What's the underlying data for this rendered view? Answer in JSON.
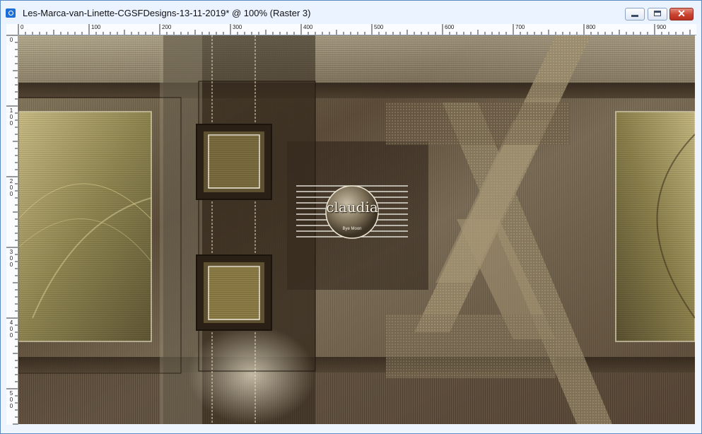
{
  "window": {
    "title": "Les-Marca-van-Linette-CGSFDesigns-13-11-2019* @ 100% (Raster 3)",
    "controls": {
      "minimize": "minimize",
      "maximize": "maximize",
      "close": "✕"
    }
  },
  "ruler_horizontal": {
    "labels": [
      "0",
      "100",
      "200",
      "300",
      "400",
      "500",
      "600",
      "700",
      "800",
      "900"
    ]
  },
  "ruler_vertical": {
    "labels": [
      [
        "0"
      ],
      [
        "1",
        "0",
        "0"
      ],
      [
        "2",
        "0",
        "0"
      ],
      [
        "3",
        "0",
        "0"
      ],
      [
        "4",
        "0",
        "0"
      ],
      [
        "5",
        "0",
        "0"
      ]
    ]
  },
  "watermark": {
    "text": "claudia",
    "subtext": "Bye Moon"
  },
  "colors": {
    "frame": "#5c8ac2",
    "titlebar": "#eaf3ff",
    "canvas_base": "#6b5f4b",
    "olive": "#8b8150",
    "dark_brown": "#3b2f22",
    "light_tan": "#c9bea0"
  }
}
